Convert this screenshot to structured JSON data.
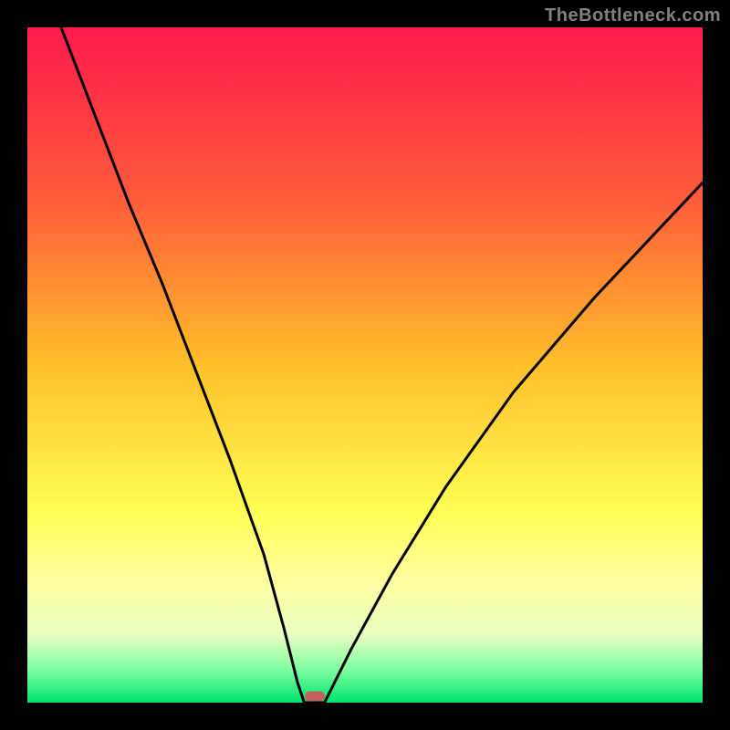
{
  "attribution": "TheBottleneck.com",
  "colors": {
    "frame": "#000000",
    "gradient_top": "#ff1a4d",
    "gradient_mid": "#ffff55",
    "gradient_bottom": "#00e36b",
    "curve": "#000000",
    "marker": "#c1625f",
    "attribution_text": "#808080"
  },
  "chart_data": {
    "type": "line",
    "title": "",
    "xlabel": "",
    "ylabel": "",
    "xlim": [
      0,
      100
    ],
    "ylim": [
      0,
      100
    ],
    "grid": false,
    "legend": false,
    "annotations": [
      "TheBottleneck.com"
    ],
    "series": [
      {
        "name": "left-branch",
        "x": [
          5,
          10,
          15,
          20,
          25,
          30,
          35,
          38,
          40,
          41
        ],
        "y": [
          100,
          87,
          74,
          62,
          49,
          36,
          22,
          11,
          3,
          0
        ]
      },
      {
        "name": "floor",
        "x": [
          41,
          42,
          43,
          44
        ],
        "y": [
          0,
          0,
          0,
          0
        ]
      },
      {
        "name": "right-branch",
        "x": [
          44,
          48,
          54,
          62,
          72,
          84,
          100
        ],
        "y": [
          0,
          8,
          19,
          32,
          46,
          60,
          77
        ]
      }
    ],
    "marker": {
      "x": 42.5,
      "y": 1
    }
  }
}
